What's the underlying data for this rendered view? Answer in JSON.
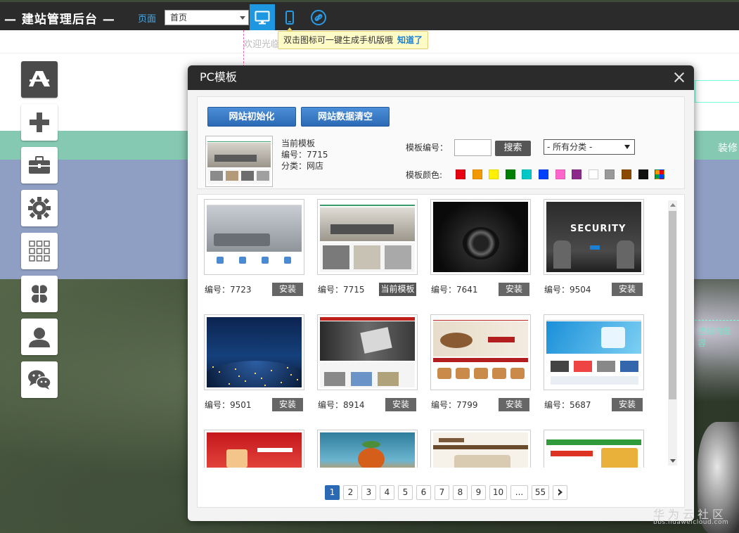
{
  "topbar": {
    "title": "— 建站管理后台 —",
    "page_label": "页面",
    "page_select_value": "首页",
    "tooltip_text": "双击图标可一键生成手机版哦",
    "tooltip_ok": "知道了"
  },
  "background": {
    "welcome_text": "欢迎光临",
    "decorate_text": "装修",
    "dashed_hint_text": "虚线内是容"
  },
  "side_toolbar": [
    {
      "name": "app-store-icon"
    },
    {
      "name": "plus-icon"
    },
    {
      "name": "toolbox-icon"
    },
    {
      "name": "gear-icon"
    },
    {
      "name": "grid-icon"
    },
    {
      "name": "clover-icon"
    },
    {
      "name": "user-icon"
    },
    {
      "name": "wechat-icon"
    }
  ],
  "modal": {
    "title": "PC模板",
    "btn_init": "网站初始化",
    "btn_clear": "网站数据清空",
    "current_label": "当前模板",
    "current_number": "编号：7715",
    "current_category": "分类：网店",
    "template_number_label": "模板编号：",
    "search_label": "搜索",
    "category_select_value": "- 所有分类 -",
    "color_label": "模板颜色:",
    "colors": [
      "#e60012",
      "#f39800",
      "#fff100",
      "#008000",
      "#00c8c8",
      "#0040ff",
      "#ff66cc",
      "#8c2a8c",
      "#ffffff",
      "#999999",
      "#8c4a00",
      "#111111",
      "multi"
    ],
    "templates": [
      {
        "number": "编号：7723",
        "action": "安装",
        "current": false,
        "style": "living"
      },
      {
        "number": "编号：7715",
        "action": "当前模板",
        "current": true,
        "style": "furniture"
      },
      {
        "number": "编号：7641",
        "action": "安装",
        "current": false,
        "style": "dark-lens"
      },
      {
        "number": "编号：9504",
        "action": "安装",
        "current": false,
        "style": "security"
      },
      {
        "number": "编号：9501",
        "action": "安装",
        "current": false,
        "style": "earth"
      },
      {
        "number": "编号：8914",
        "action": "安装",
        "current": false,
        "style": "reader"
      },
      {
        "number": "编号：7799",
        "action": "安装",
        "current": false,
        "style": "food"
      },
      {
        "number": "编号：5687",
        "action": "安装",
        "current": false,
        "style": "tech"
      },
      {
        "number": "",
        "action": "",
        "current": false,
        "style": "red"
      },
      {
        "number": "",
        "action": "",
        "current": false,
        "style": "orange"
      },
      {
        "number": "",
        "action": "",
        "current": false,
        "style": "sofa"
      },
      {
        "number": "",
        "action": "",
        "current": false,
        "style": "snack"
      }
    ],
    "pages": [
      "1",
      "2",
      "3",
      "4",
      "5",
      "6",
      "7",
      "8",
      "9",
      "10",
      "...",
      "55"
    ],
    "active_page": "1"
  },
  "watermark": {
    "text": "华为云社区",
    "url": "bbs.huaweicloud.com"
  }
}
